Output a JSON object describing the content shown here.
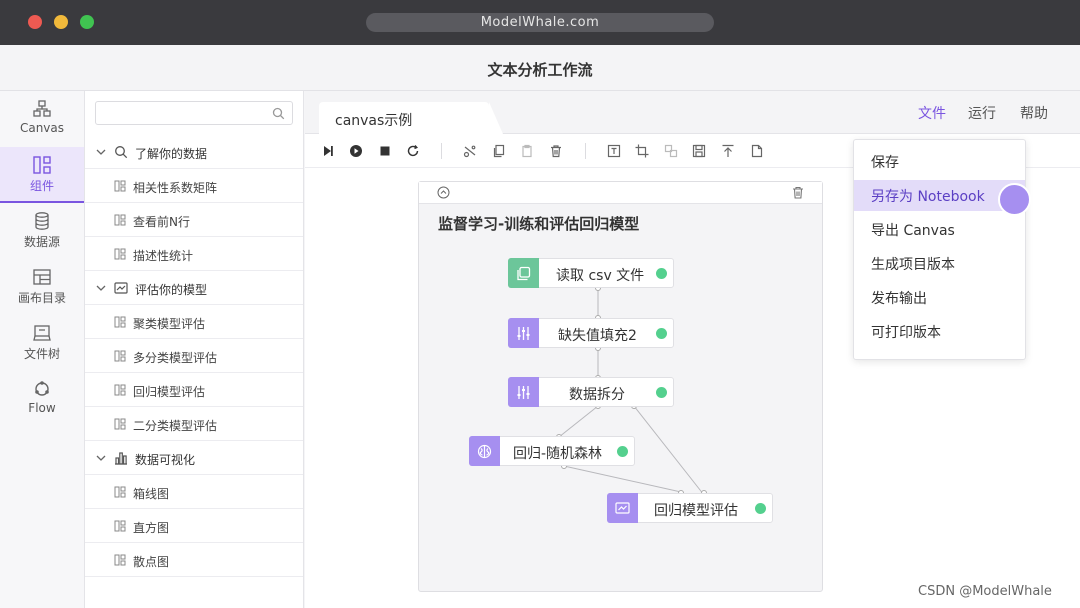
{
  "window": {
    "url": "ModelWhale.com"
  },
  "app": {
    "title": "文本分析工作流"
  },
  "rail": [
    {
      "label": "Canvas",
      "icon": "canvas-icon"
    },
    {
      "label": "组件",
      "icon": "components-icon",
      "active": true
    },
    {
      "label": "数据源",
      "icon": "database-icon"
    },
    {
      "label": "画布目录",
      "icon": "canvas-directory-icon"
    },
    {
      "label": "文件树",
      "icon": "file-tree-icon"
    },
    {
      "label": "Flow",
      "icon": "flow-icon"
    }
  ],
  "panel": {
    "search_placeholder": "",
    "groups": [
      {
        "label": "了解你的数据",
        "icon": "search-icon",
        "items": [
          "相关性系数矩阵",
          "查看前N行",
          "描述性统计"
        ]
      },
      {
        "label": "评估你的模型",
        "icon": "chart-line-icon",
        "items": [
          "聚类模型评估",
          "多分类模型评估",
          "回归模型评估",
          "二分类模型评估"
        ]
      },
      {
        "label": "数据可视化",
        "icon": "bar-chart-icon",
        "items": [
          "箱线图",
          "直方图",
          "散点图"
        ]
      }
    ]
  },
  "tabs": [
    {
      "label": "canvas示例"
    }
  ],
  "menu": {
    "file": "文件",
    "run": "运行",
    "help": "帮助"
  },
  "canvas": {
    "group_title": "监督学习-训练和评估回归模型",
    "nodes": [
      {
        "label": "读取 csv 文件",
        "icon": "file-copy-icon",
        "color": "#6cc69a"
      },
      {
        "label": "缺失值填充2",
        "icon": "sliders-icon",
        "color": "#a68ff0"
      },
      {
        "label": "数据拆分",
        "icon": "sliders-icon",
        "color": "#a68ff0"
      },
      {
        "label": "回归-随机森林",
        "icon": "brain-icon",
        "color": "#a68ff0"
      },
      {
        "label": "回归模型评估",
        "icon": "monitor-chart-icon",
        "color": "#a68ff0"
      }
    ]
  },
  "dropdown": {
    "items": [
      "保存",
      "另存为 Notebook",
      "导出 Canvas",
      "生成项目版本",
      "发布输出",
      "可打印版本"
    ],
    "highlighted": "另存为 Notebook"
  },
  "colors": {
    "accent": "#7a55e0",
    "status_ok": "#54d08e",
    "highlight_bg": "#e3dcf9"
  },
  "watermark": "CSDN @ModelWhale"
}
